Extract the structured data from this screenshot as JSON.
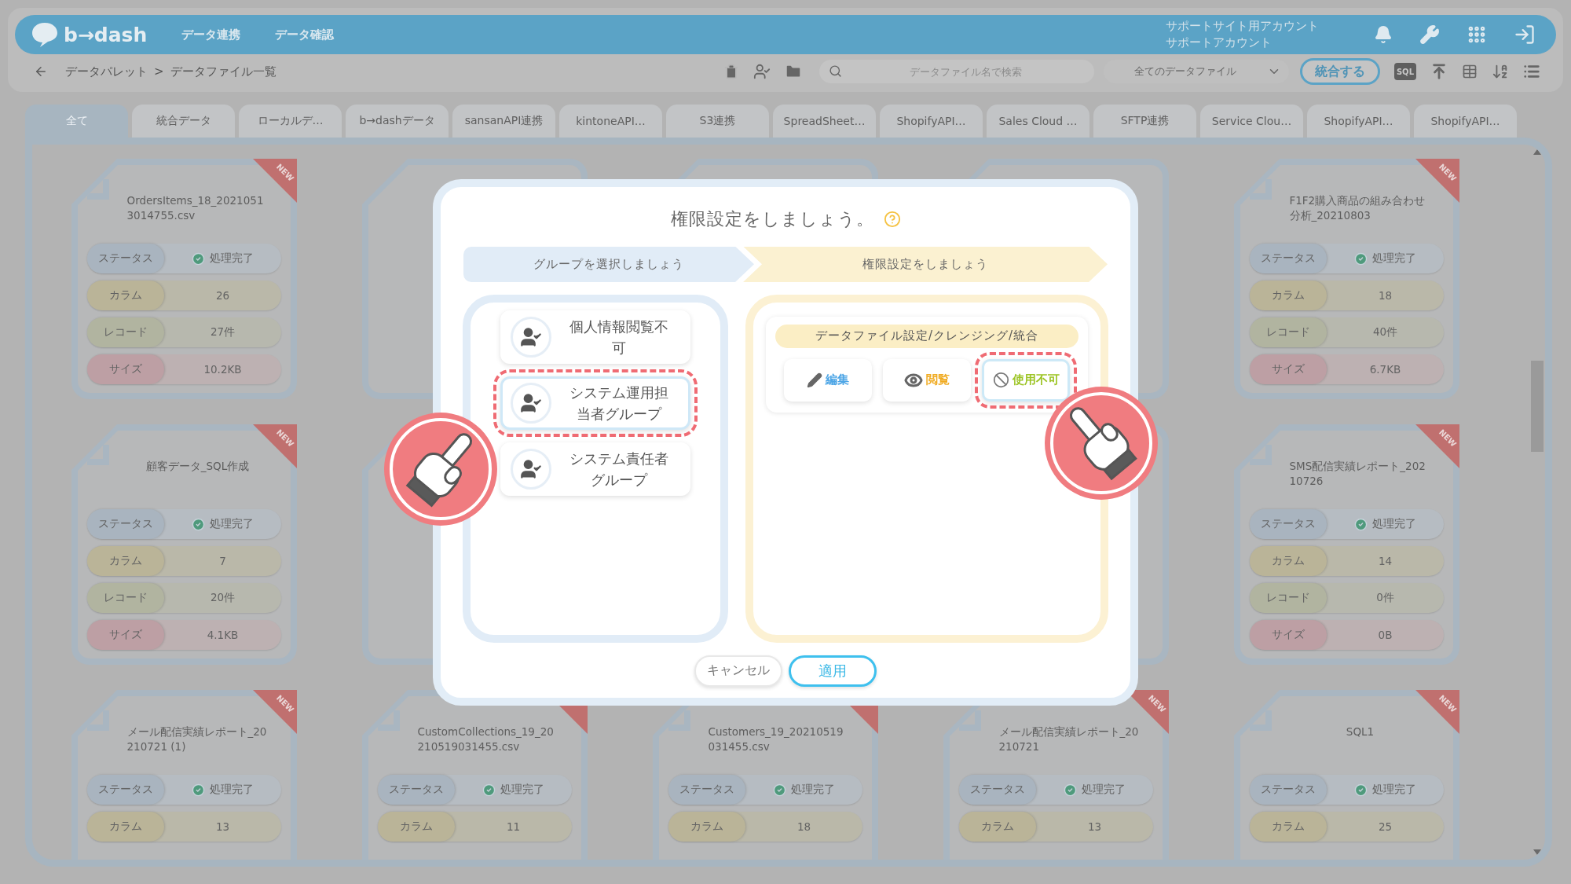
{
  "header": {
    "logo": "b→dash",
    "nav": [
      {
        "label": "データ連携"
      },
      {
        "label": "データ確認"
      }
    ],
    "account": [
      "サポートサイト用アカウント",
      "サポートアカウント"
    ]
  },
  "toolbar": {
    "breadcrumb": [
      "データパレット",
      "データファイル一覧"
    ],
    "separator": ">",
    "search": {
      "placeholder": "データファイル名で検索"
    },
    "filter": {
      "value": "全てのデータファイル"
    },
    "merge_button": "統合する",
    "sql_button": "SQL"
  },
  "tabs": [
    {
      "label": "全て",
      "selected": true
    },
    {
      "label": "統合データ",
      "selected": false
    },
    {
      "label": "ローカルデ…",
      "selected": false
    },
    {
      "label": "b→dashデータ",
      "selected": false
    },
    {
      "label": "sansanAPI連携",
      "selected": false
    },
    {
      "label": "kintoneAPI…",
      "selected": false
    },
    {
      "label": "S3連携",
      "selected": false
    },
    {
      "label": "SpreadSheet…",
      "selected": false
    },
    {
      "label": "ShopifyAPI…",
      "selected": false
    },
    {
      "label": "Sales Cloud …",
      "selected": false
    },
    {
      "label": "SFTP連携",
      "selected": false
    },
    {
      "label": "Service Clou…",
      "selected": false
    },
    {
      "label": "ShopifyAPI…",
      "selected": false
    },
    {
      "label": "ShopifyAPI…",
      "selected": false
    }
  ],
  "cards": [
    {
      "kind": "file",
      "title": "OrdersItems_18_20210513014755.csv",
      "is_new": true,
      "badge": "NEW",
      "rows": [
        {
          "kind": "status",
          "label": "ステータス",
          "value": "処理完了"
        },
        {
          "kind": "columns",
          "label": "カラム",
          "value": "26"
        },
        {
          "kind": "records",
          "label": "レコード",
          "value": "27件"
        },
        {
          "kind": "size",
          "label": "サイズ",
          "value": "10.2KB"
        }
      ]
    },
    {
      "kind": "covered"
    },
    {
      "kind": "covered"
    },
    {
      "kind": "covered"
    },
    {
      "kind": "file",
      "title": "F1F2購入商品の組み合わせ分析_20210803",
      "is_new": true,
      "badge": "NEW",
      "rows": [
        {
          "kind": "status",
          "label": "ステータス",
          "value": "処理完了"
        },
        {
          "kind": "columns",
          "label": "カラム",
          "value": "18"
        },
        {
          "kind": "records",
          "label": "レコード",
          "value": "40件"
        },
        {
          "kind": "size",
          "label": "サイズ",
          "value": "6.7KB"
        }
      ]
    },
    {
      "kind": "file",
      "title": "顧客データ_SQL作成",
      "is_new": true,
      "badge": "NEW",
      "rows": [
        {
          "kind": "status",
          "label": "ステータス",
          "value": "処理完了"
        },
        {
          "kind": "columns",
          "label": "カラム",
          "value": "7"
        },
        {
          "kind": "records",
          "label": "レコード",
          "value": "20件"
        },
        {
          "kind": "size",
          "label": "サイズ",
          "value": "4.1KB"
        }
      ]
    },
    {
      "kind": "covered"
    },
    {
      "kind": "spacer"
    },
    {
      "kind": "covered"
    },
    {
      "kind": "file",
      "title": "SMS配信実績レポート_20210726",
      "is_new": true,
      "badge": "NEW",
      "rows": [
        {
          "kind": "status",
          "label": "ステータス",
          "value": "処理完了"
        },
        {
          "kind": "columns",
          "label": "カラム",
          "value": "14"
        },
        {
          "kind": "records",
          "label": "レコード",
          "value": "0件"
        },
        {
          "kind": "size",
          "label": "サイズ",
          "value": "0B"
        }
      ]
    },
    {
      "kind": "file",
      "title": "メール配信実績レポート_20210721 (1)",
      "is_new": true,
      "badge": "NEW",
      "rows": [
        {
          "kind": "status",
          "label": "ステータス",
          "value": "処理完了"
        },
        {
          "kind": "columns",
          "label": "カラム",
          "value": "13"
        }
      ]
    },
    {
      "kind": "file",
      "title": "CustomCollections_19_20210519031455.csv",
      "is_new": true,
      "rows": [
        {
          "kind": "status",
          "label": "ステータス",
          "value": "処理完了"
        },
        {
          "kind": "columns",
          "label": "カラム",
          "value": "11"
        }
      ]
    },
    {
      "kind": "file",
      "title": "Customers_19_20210519031455.csv",
      "is_new": true,
      "rows": [
        {
          "kind": "status",
          "label": "ステータス",
          "value": "処理完了"
        },
        {
          "kind": "columns",
          "label": "カラム",
          "value": "18"
        }
      ]
    },
    {
      "kind": "file",
      "title": "メール配信実績レポート_20210721",
      "is_new": true,
      "badge": "NEW",
      "rows": [
        {
          "kind": "status",
          "label": "ステータス",
          "value": "処理完了"
        },
        {
          "kind": "columns",
          "label": "カラム",
          "value": "13"
        }
      ]
    },
    {
      "kind": "file",
      "title": "SQL1",
      "is_new": true,
      "badge": "NEW",
      "rows": [
        {
          "kind": "status",
          "label": "ステータス",
          "value": "処理完了"
        },
        {
          "kind": "columns",
          "label": "カラム",
          "value": "25"
        }
      ]
    }
  ],
  "dialog": {
    "title": "権限設定をしましょう。",
    "steps": [
      {
        "kind": "group",
        "label": "グループを選択しましょう"
      },
      {
        "kind": "permission",
        "label": "権限設定をしましょう"
      }
    ],
    "groups": [
      {
        "name": "個人情報閲覧不可",
        "selected": false
      },
      {
        "name": "システム運用担当者グループ",
        "selected": true
      },
      {
        "name": "システム責任者グループ",
        "selected": false
      }
    ],
    "permission": {
      "category": "データファイル設定/クレンジング/統合",
      "options": [
        {
          "kind": "edit",
          "label": "編集",
          "selected": false
        },
        {
          "kind": "view",
          "label": "閲覧",
          "selected": false
        },
        {
          "kind": "deny",
          "label": "使用不可",
          "selected": true
        }
      ]
    },
    "buttons": [
      {
        "kind": "cancel",
        "label": "キャンセル"
      },
      {
        "kind": "apply",
        "label": "適用"
      }
    ]
  }
}
